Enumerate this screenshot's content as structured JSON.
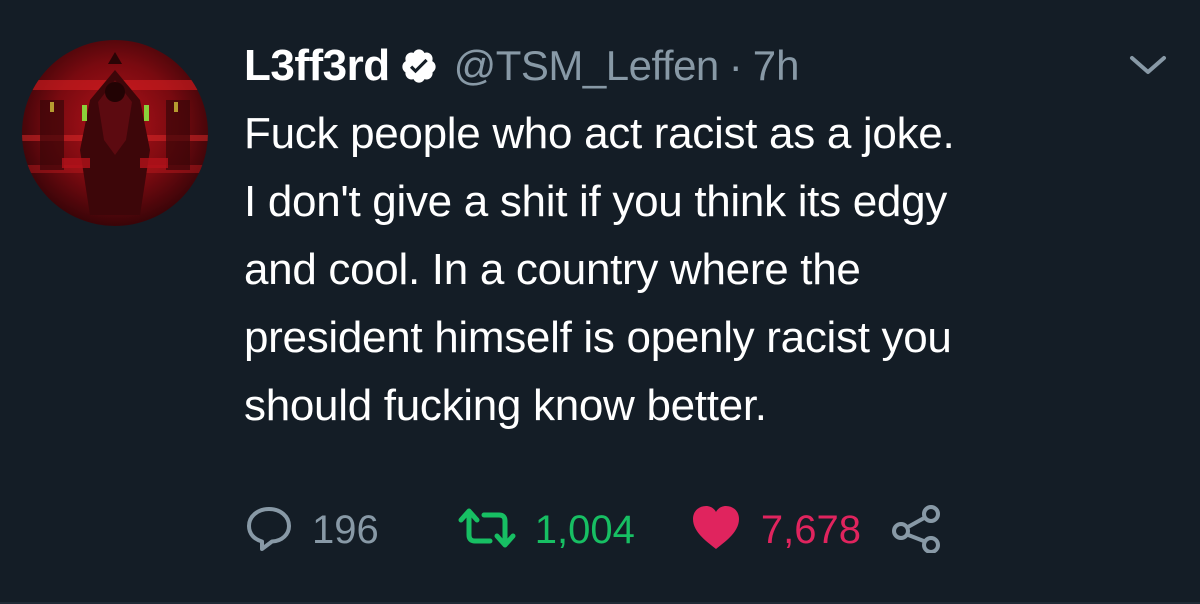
{
  "tweet": {
    "display_name": "L3ff3rd",
    "handle": "@TSM_Leffen",
    "separator": "·",
    "time": "7h",
    "verified": true,
    "lines": [
      "Fuck people who act racist as a joke.",
      "I don't give a shit if you think its edgy",
      "and cool. In a country where the",
      "president himself is openly racist you",
      "should fucking know better."
    ]
  },
  "actions": {
    "reply_count": "196",
    "retweet_count": "1,004",
    "like_count": "7,678"
  },
  "colors": {
    "background": "#141d26",
    "secondary_text": "#8899a6",
    "retweet_active": "#17bf63",
    "like_active": "#e0245e",
    "verified_badge": "#ffffff"
  },
  "icons": {
    "avatar": "avatar-image",
    "verified": "verified-badge-icon",
    "menu": "chevron-down-icon",
    "reply": "reply-icon",
    "retweet": "retweet-icon",
    "like": "heart-icon",
    "share": "share-icon"
  }
}
